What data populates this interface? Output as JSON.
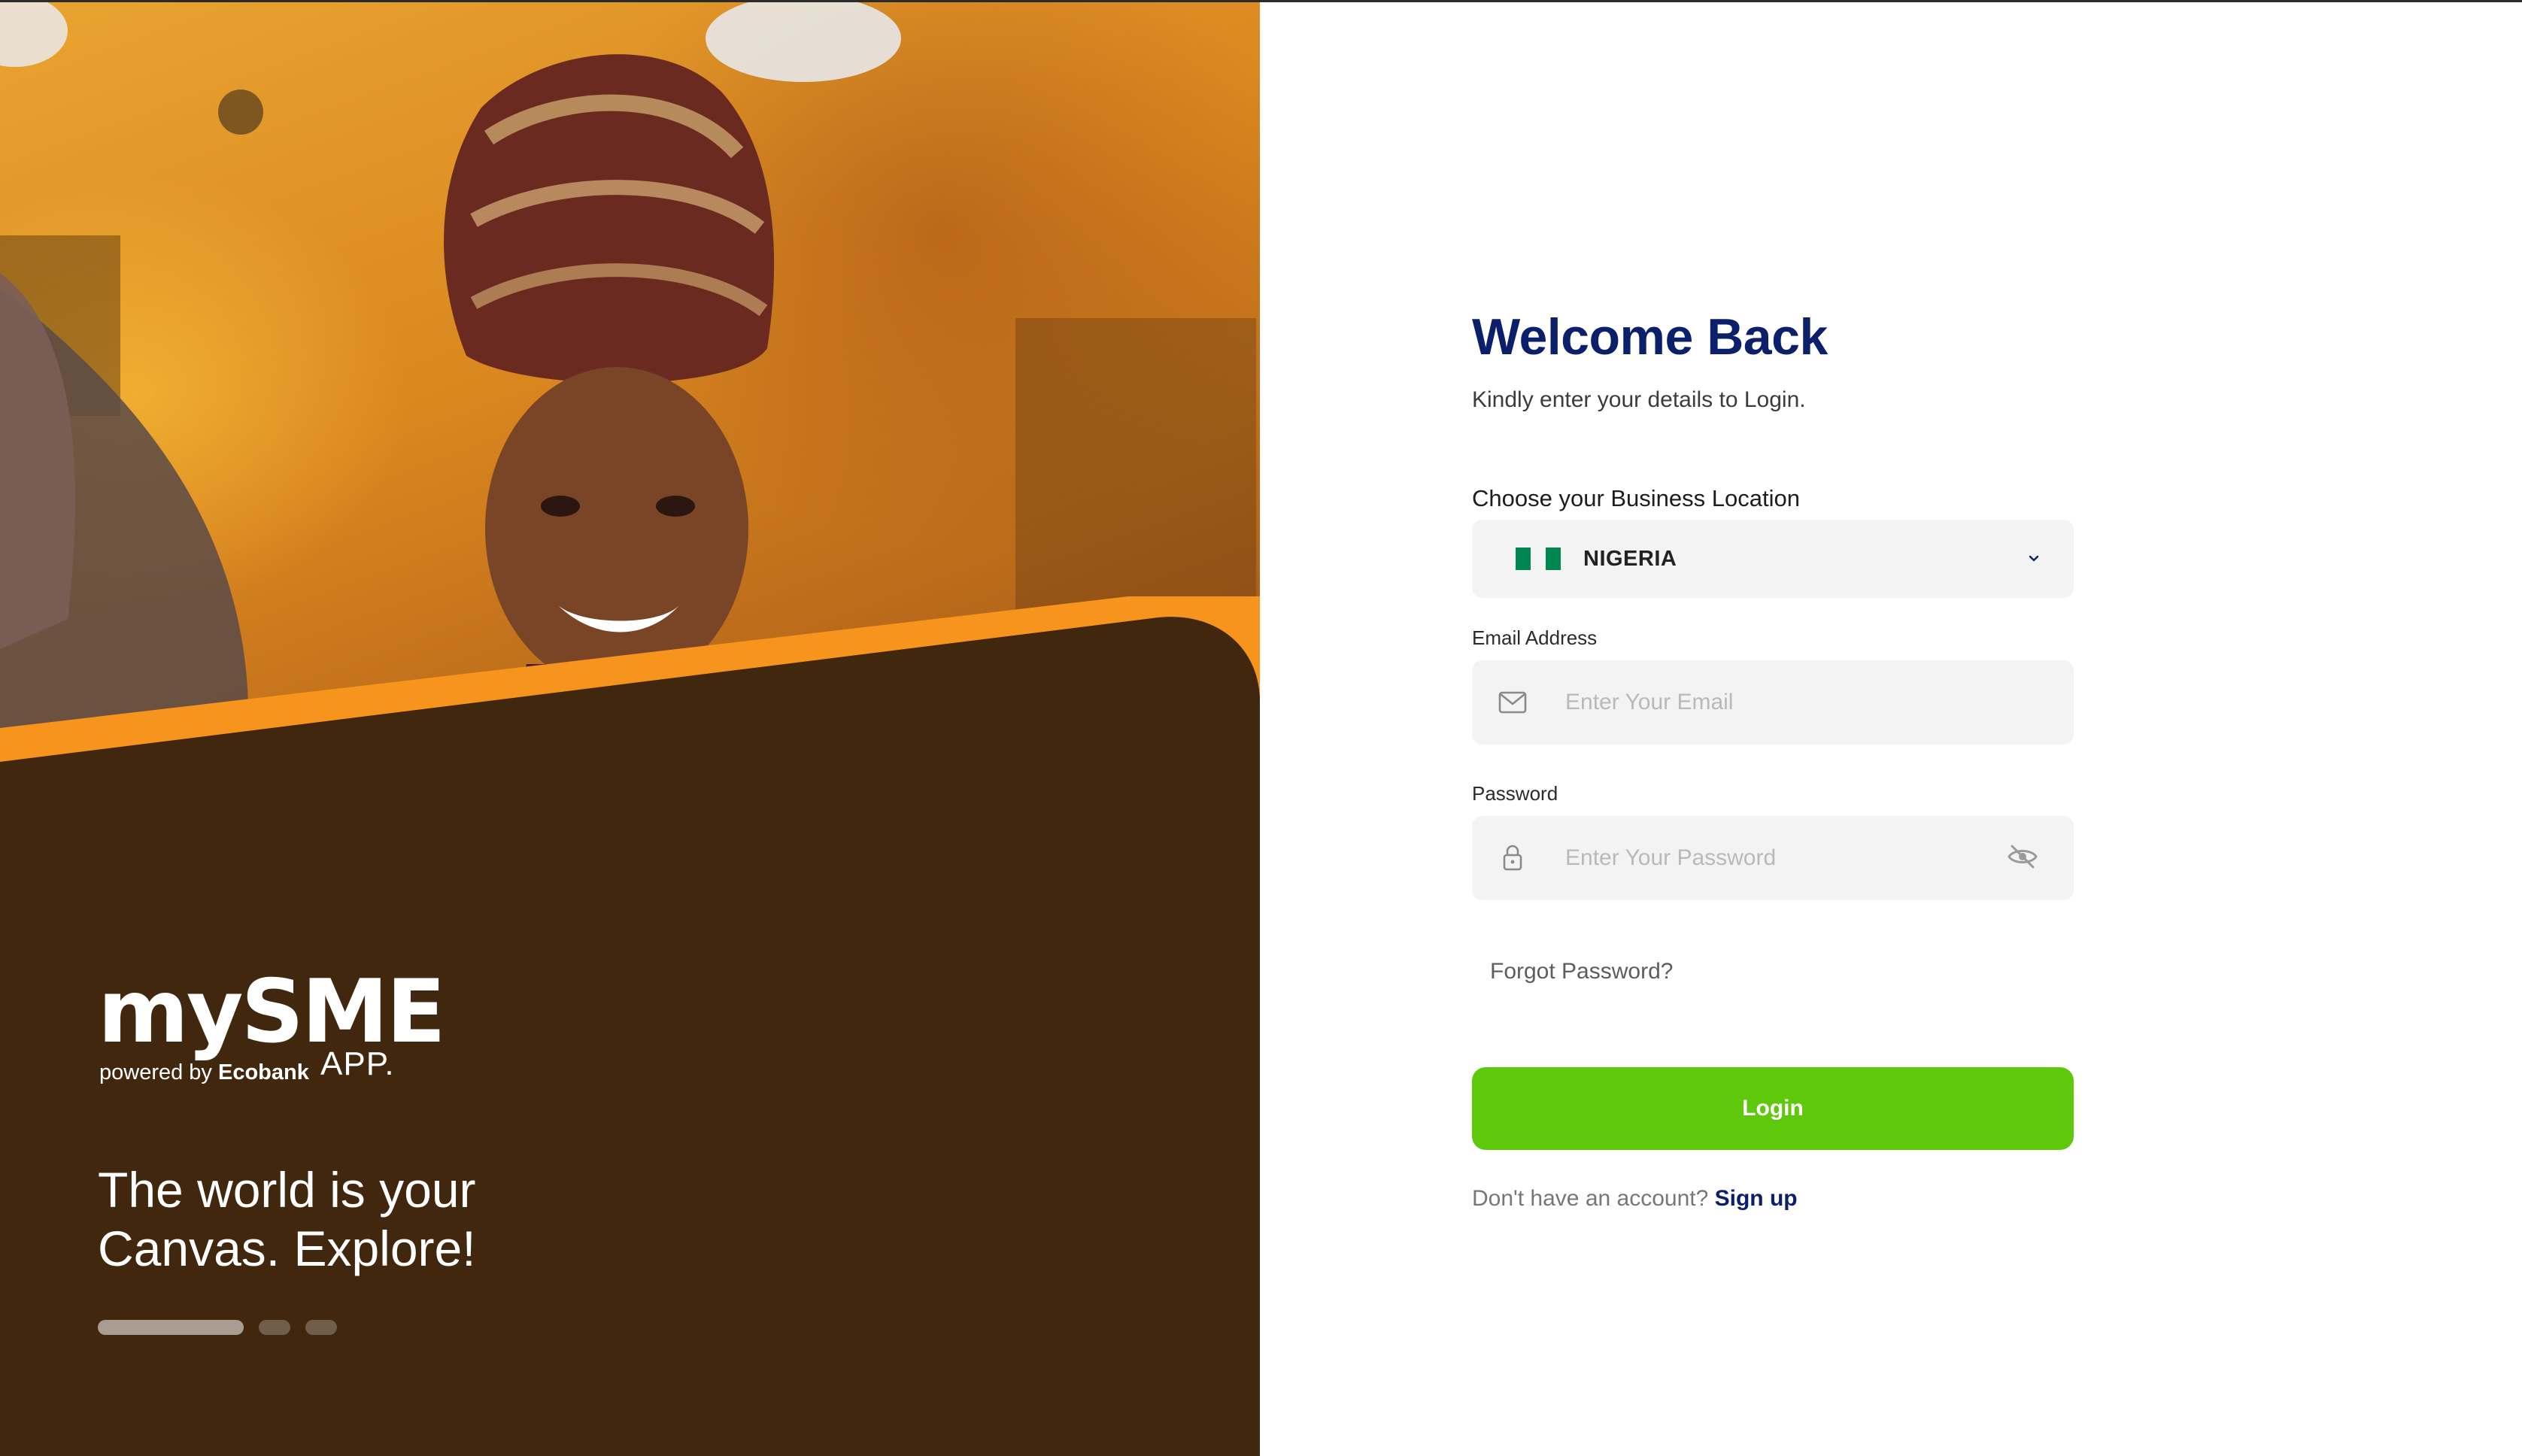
{
  "hero": {
    "brand_logo": "mySME",
    "brand_powered_prefix": "powered by",
    "brand_powered_company": "Ecobank",
    "brand_app_suffix": "APP.",
    "tagline_line1": "The world is your",
    "tagline_line2": "Canvas. Explore!",
    "carousel": {
      "total_slides": 3,
      "active_index": 0
    }
  },
  "login": {
    "title": "Welcome Back",
    "subtitle": "Kindly enter your details to Login.",
    "location": {
      "label": "Choose your Business Location",
      "selected": "NIGERIA",
      "flag_icon": "nigeria-flag-icon"
    },
    "email": {
      "label": "Email Address",
      "placeholder": "Enter Your Email",
      "icon": "mail-icon"
    },
    "password": {
      "label": "Password",
      "placeholder": "Enter Your Password",
      "icon": "lock-icon",
      "toggle_icon": "eye-off-icon"
    },
    "forgot_label": "Forgot Password?",
    "login_label": "Login",
    "signup_prompt": "Don't have an account?",
    "signup_label": "Sign up"
  },
  "colors": {
    "title": "#0b1f6b",
    "accent_green": "#5dc90a",
    "hero_stripe": "#f7941d",
    "field_bg": "#f3f3f3"
  }
}
